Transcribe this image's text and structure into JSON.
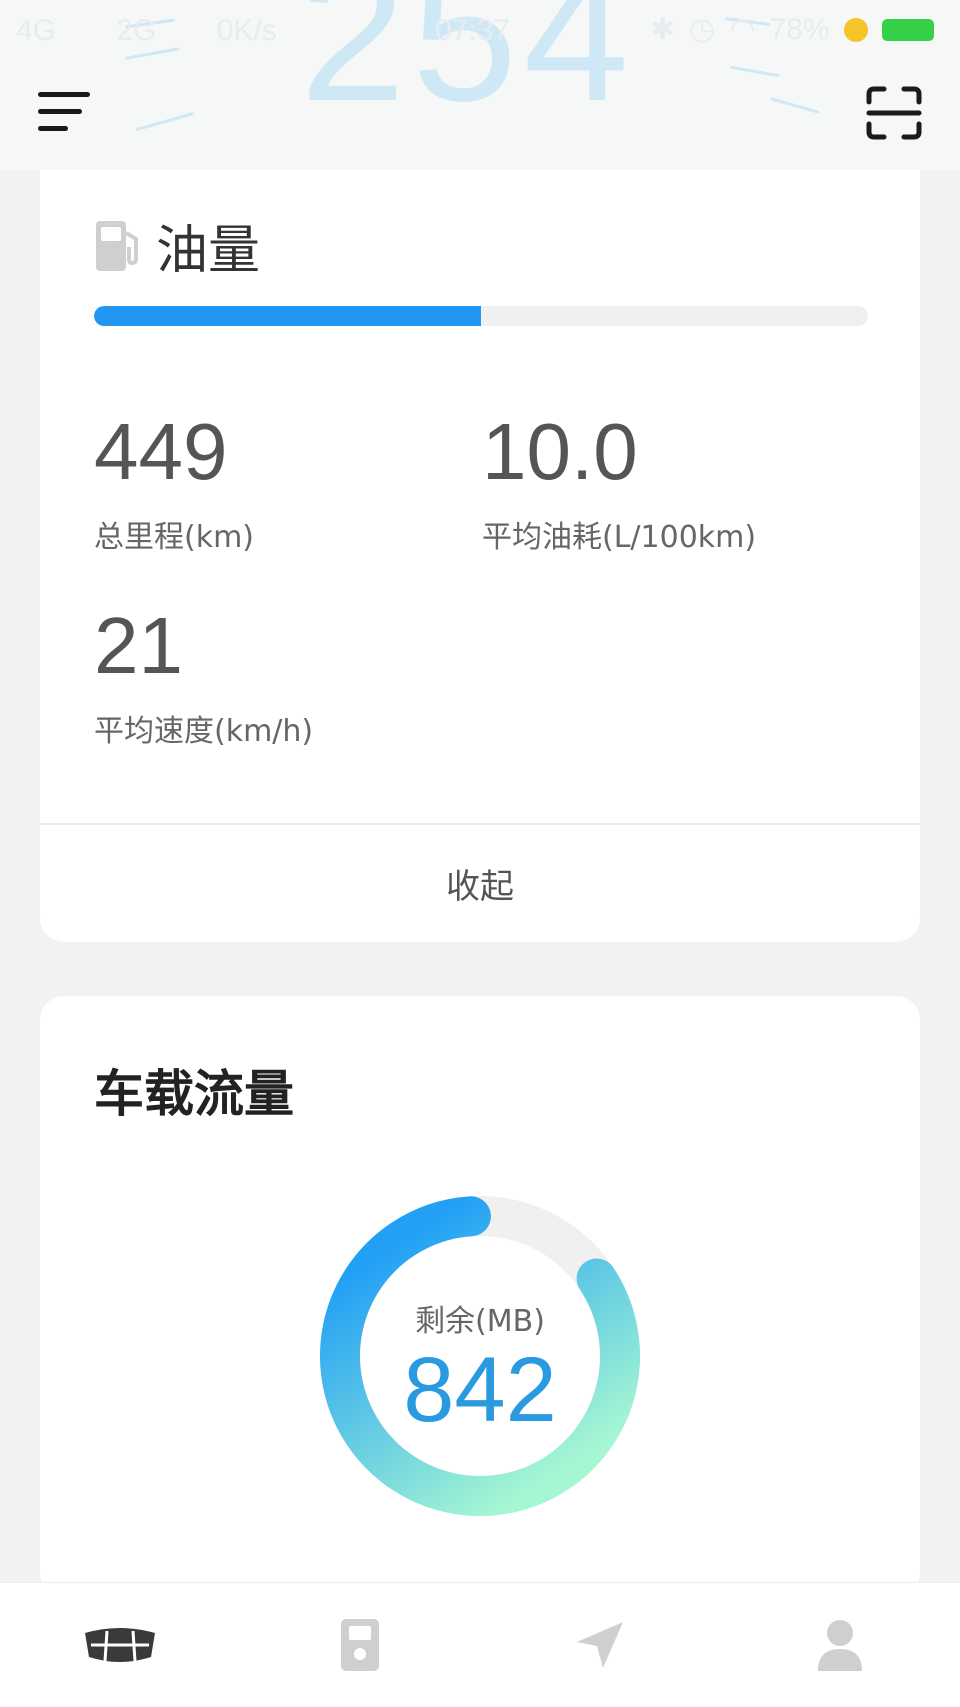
{
  "status_bar": {
    "network_left": "4G",
    "network_2g": "2G",
    "speed": "0K/s",
    "time": "07:37",
    "battery": "78%",
    "icons": [
      "signal-icon",
      "wechat-icon",
      "bluetooth-icon",
      "alarm-icon",
      "wifi-icon",
      "charging-icon",
      "battery-icon"
    ]
  },
  "header": {
    "background_number": "254",
    "menu_icon": "menu-icon",
    "scan_icon": "scan-icon"
  },
  "fuel_card": {
    "icon": "fuel-pump-icon",
    "title": "油量",
    "level_percent": 50,
    "stats": [
      {
        "value": "449",
        "label": "总里程(km)"
      },
      {
        "value": "10.0",
        "label": "平均油耗(L/100km)"
      },
      {
        "value": "21",
        "label": "平均速度(km/h)"
      }
    ],
    "collapse_label": "收起"
  },
  "data_card": {
    "title": "车载流量",
    "remaining_label": "剩余(MB)",
    "remaining_value": "842",
    "used_fraction": 0.14
  },
  "bottom_nav": {
    "items": [
      {
        "icon": "geely-logo-icon",
        "active": true
      },
      {
        "icon": "phone-key-icon",
        "active": false
      },
      {
        "icon": "navigation-icon",
        "active": false
      },
      {
        "icon": "user-icon",
        "active": false
      }
    ]
  },
  "colors": {
    "accent": "#2196f3",
    "ring_top": "#22a0f5",
    "ring_bottom": "#a5f6d2",
    "value_blue": "#2a9ae0"
  }
}
